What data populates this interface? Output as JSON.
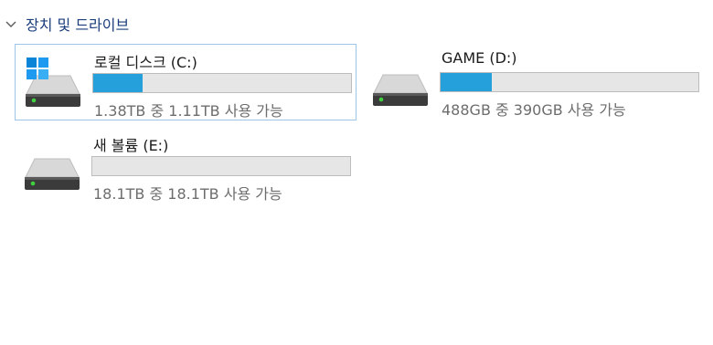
{
  "section": {
    "title": "장치 및 드라이브"
  },
  "drives": [
    {
      "name": "로컬 디스크 (C:)",
      "size_text": "1.38TB 중 1.11TB 사용 가능",
      "used_fraction": 0.19,
      "icon": "windows-hard-drive-icon",
      "selected": true
    },
    {
      "name": "GAME (D:)",
      "size_text": "488GB 중 390GB 사용 가능",
      "used_fraction": 0.2,
      "icon": "hard-drive-icon",
      "selected": false
    },
    {
      "name": "새 볼륨 (E:)",
      "size_text": "18.1TB 중 18.1TB 사용 가능",
      "used_fraction": 0.0,
      "icon": "hard-drive-icon",
      "selected": false
    }
  ],
  "colors": {
    "bar_fill": "#26a0da",
    "bar_track": "#e6e6e6",
    "selection_border": "#9dc5ea",
    "section_title": "#1a3d7c",
    "drive_led": "#3fd13f"
  }
}
